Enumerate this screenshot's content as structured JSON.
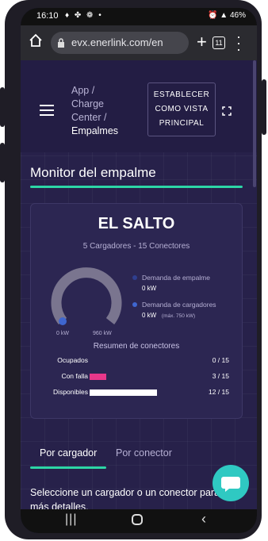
{
  "status_bar": {
    "time": "16:10",
    "left_icons": "♦ ✤ ❁ •",
    "battery": "46%"
  },
  "browser": {
    "url": "evx.enerlink.com/en",
    "tab_count": "11"
  },
  "breadcrumb": {
    "app": "App /",
    "charge": "Charge",
    "center": "Center /",
    "current": "Empalmes"
  },
  "set_main_button": {
    "line1": "ESTABLECER",
    "line2": "COMO VISTA",
    "line3": "PRINCIPAL"
  },
  "section_title": "Monitor del empalme",
  "card": {
    "title": "EL SALTO",
    "subtitle": "5 Cargadores - 15 Conectores",
    "gauge": {
      "min_label": "0 kW",
      "max_label": "960 kW",
      "value_fraction": 0.0
    },
    "legend": [
      {
        "label": "Demanda de empalme",
        "value": "0 kW",
        "note": "",
        "color": "#2f3f8f"
      },
      {
        "label": "Demanda de cargadores",
        "value": "0 kW",
        "note": "(máx. 750 kW)",
        "color": "#3f66d0"
      }
    ],
    "summary_title": "Resumen de conectores",
    "rows": [
      {
        "label": "Ocupados",
        "count": "0 / 15",
        "fraction": 0.0,
        "color": "#8a86a8"
      },
      {
        "label": "Con falla",
        "count": "3 / 15",
        "fraction": 0.2,
        "color": "#e8378a"
      },
      {
        "label": "Disponibles",
        "count": "12 / 15",
        "fraction": 0.8,
        "color": "#ffffff"
      }
    ]
  },
  "tabs": {
    "active": "Por cargador",
    "inactive": "Por conector"
  },
  "hint": "Seleccione un cargador o un conector para más detalles.",
  "colors": {
    "accent": "#2dd6a6",
    "background": "#27214a",
    "chat": "#2fc9c2"
  },
  "icons": [
    "home-icon",
    "lock-icon",
    "plus-icon",
    "tabs-icon",
    "kebab-menu-icon",
    "hamburger-icon",
    "fullscreen-icon",
    "chat-icon"
  ]
}
